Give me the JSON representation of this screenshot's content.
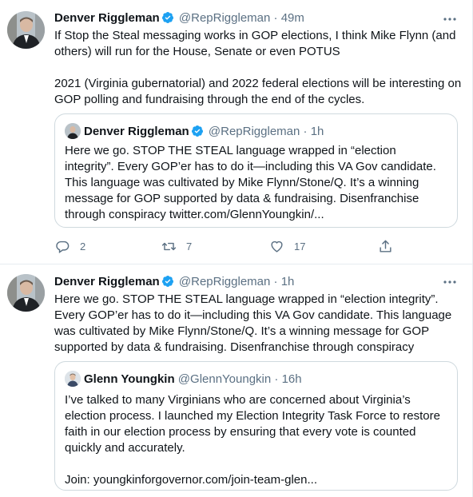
{
  "tweets": [
    {
      "author": {
        "name": "Denver Riggleman",
        "handle": "@RepRiggleman",
        "time": "49m"
      },
      "text": [
        "If Stop the Steal messaging works in GOP elections, I think Mike Flynn (and others) will run for the House, Senate or even POTUS",
        "2021 (Virginia gubernatorial) and 2022 federal elections will be interesting on GOP polling and fundraising through the end of the cycles."
      ],
      "quote": {
        "author": {
          "name": "Denver Riggleman",
          "handle": "@RepRiggleman",
          "time": "1h"
        },
        "text": "Here we go. STOP THE STEAL language wrapped in “election integrity”. Every GOP’er has to do it—including this VA Gov candidate. This language was cultivated by Mike Flynn/Stone/Q. It’s a winning message for GOP supported by data & fundraising. Disenfranchise through conspiracy twitter.com/GlennYoungkin/..."
      },
      "actions": {
        "reply_count": "2",
        "retweet_count": "7",
        "like_count": "17"
      }
    },
    {
      "author": {
        "name": "Denver Riggleman",
        "handle": "@RepRiggleman",
        "time": "1h"
      },
      "text": [
        "Here we go. STOP THE STEAL language wrapped in “election integrity”. Every GOP’er has to do it—including this VA Gov candidate. This language was cultivated by Mike Flynn/Stone/Q. It’s a winning message for GOP supported by data & fundraising. Disenfranchise through conspiracy"
      ],
      "quote": {
        "author": {
          "name": "Glenn Youngkin",
          "handle": "@GlennYoungkin",
          "time": "16h"
        },
        "text": [
          "I’ve talked to many Virginians who are concerned about Virginia’s election process. I launched my Election Integrity Task Force to restore faith in our election process by ensuring that every vote is counted quickly and accurately.",
          "Join: youngkinforgovernor.com/join-team-glen..."
        ]
      }
    }
  ],
  "separator": "·",
  "colors": {
    "verified": "#1da1f2",
    "secondary": "#5b7083",
    "border": "#cfd9de"
  }
}
